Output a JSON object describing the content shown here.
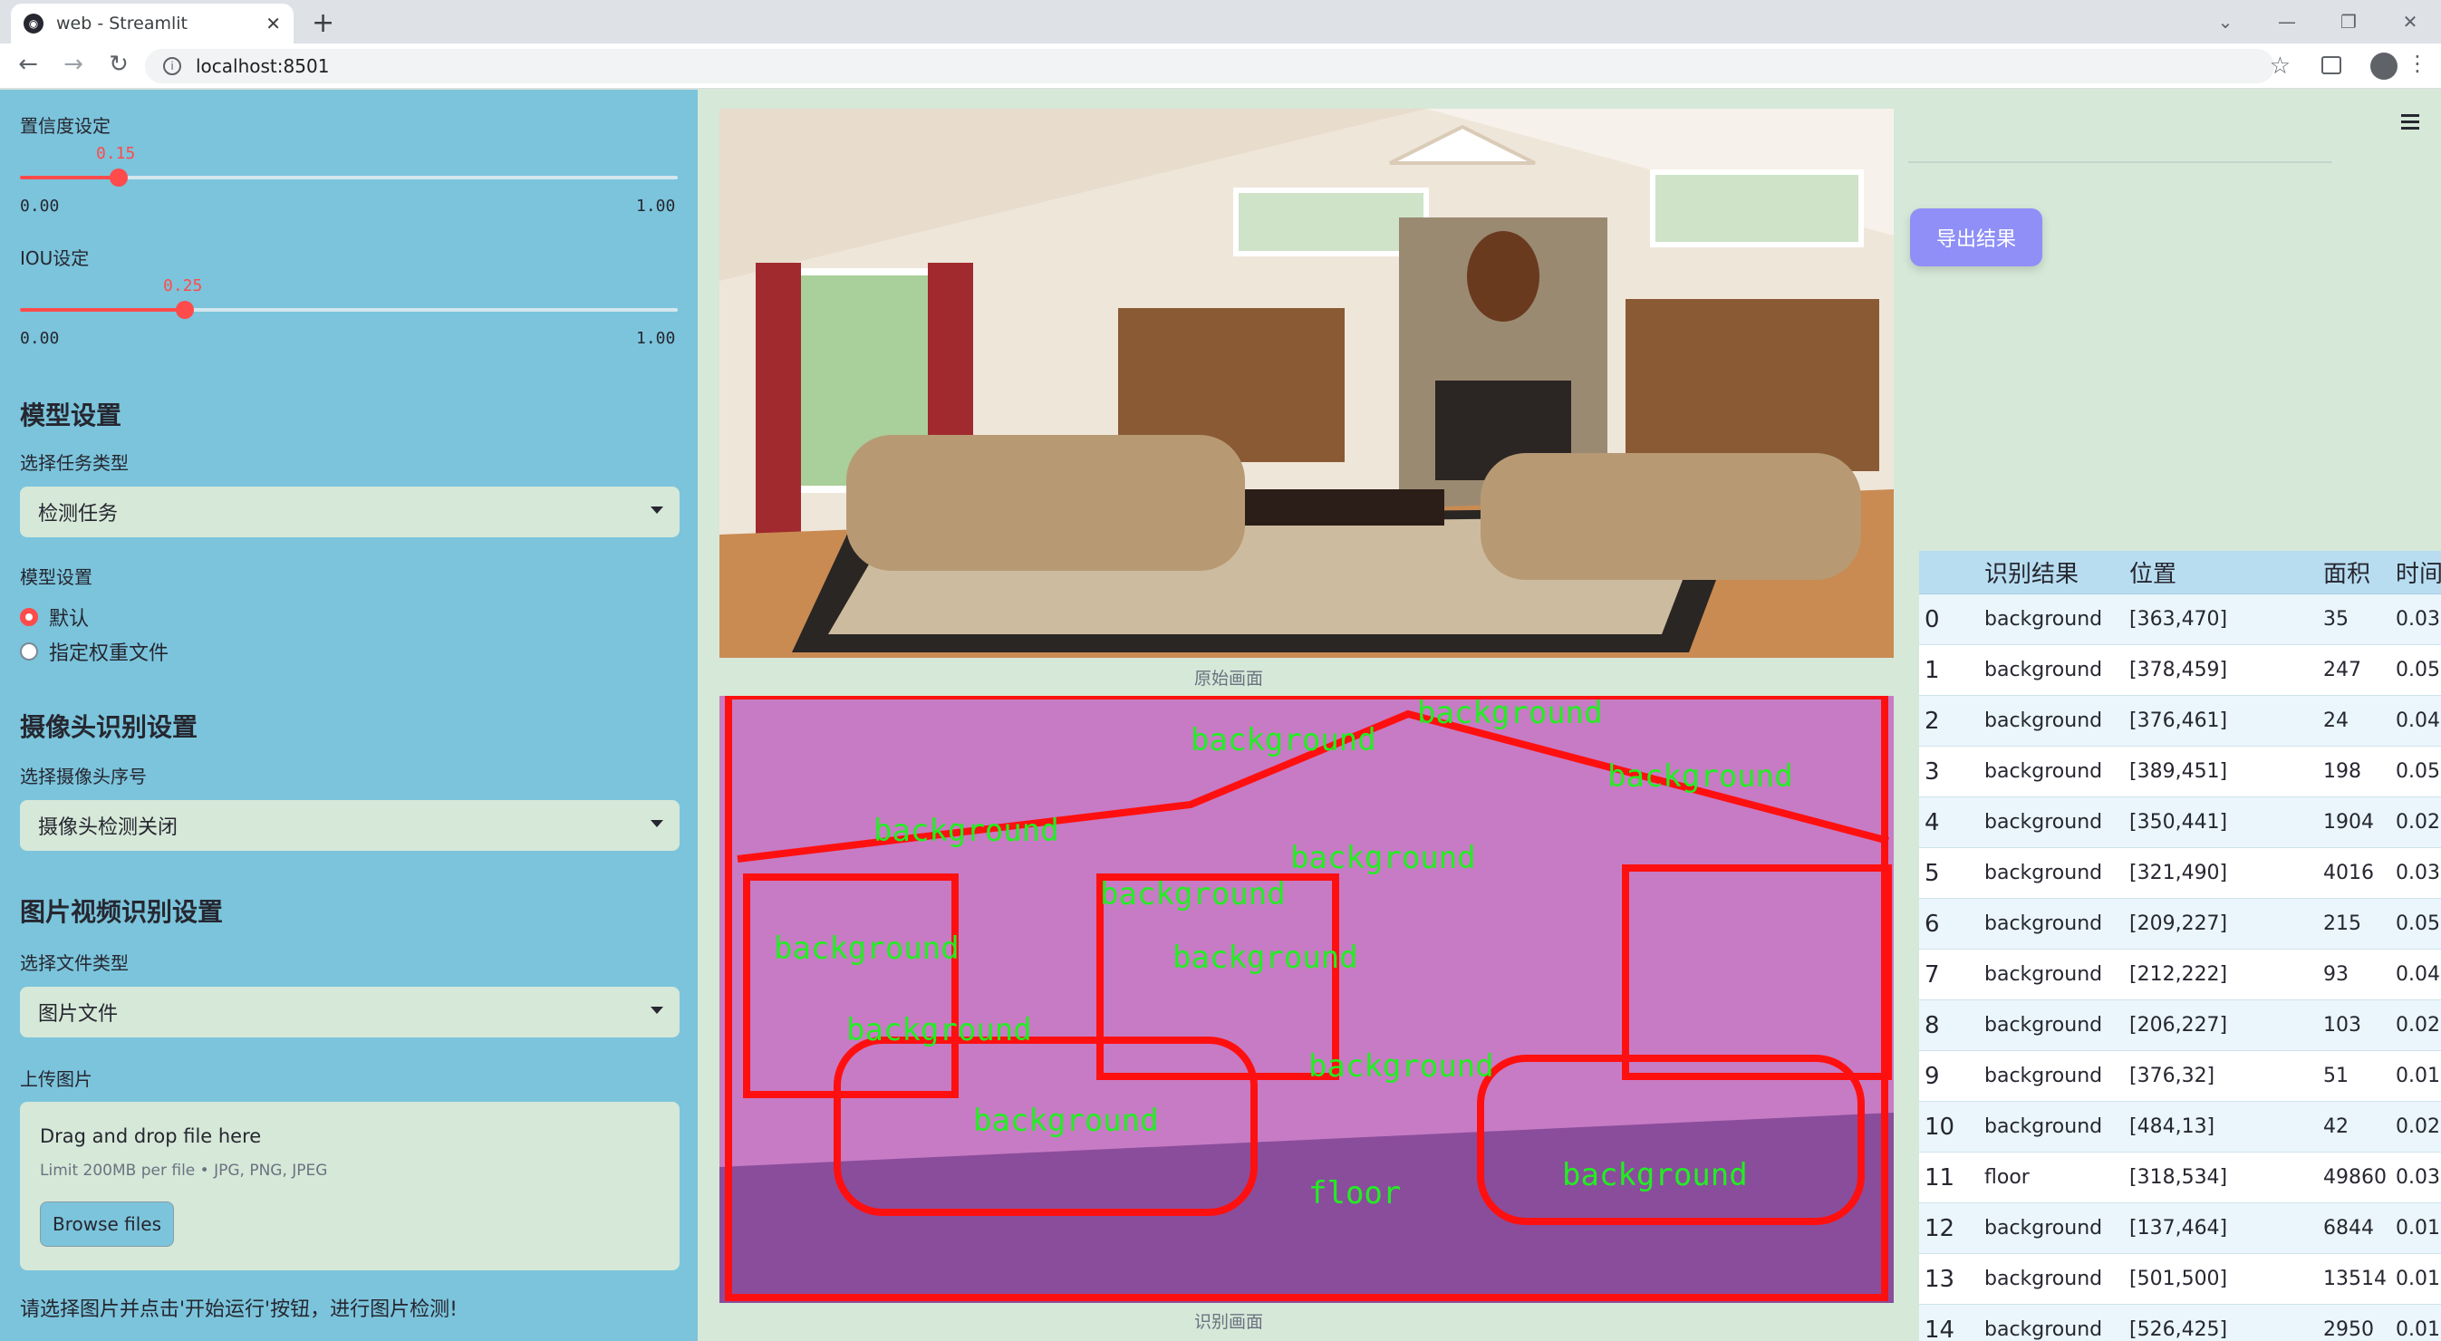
{
  "browser": {
    "tab_title": "web - Streamlit",
    "new_tab": "+",
    "url": "localhost:8501",
    "icons": [
      "streamlit-favicon",
      "close-icon",
      "back-icon",
      "forward-icon",
      "reload-icon",
      "info-icon",
      "star-icon",
      "side-panel-icon",
      "profile-icon",
      "kebab-menu-icon"
    ]
  },
  "sidebar": {
    "confidence": {
      "label": "置信度设定",
      "value": "0.15",
      "min": "0.00",
      "max": "1.00",
      "fraction": 0.15
    },
    "iou": {
      "label": "IOU设定",
      "value": "0.25",
      "min": "0.00",
      "max": "1.00",
      "fraction": 0.25
    },
    "model_section": {
      "title": "模型设置",
      "task_label": "选择任务类型",
      "task_value": "检测任务",
      "model_label": "模型设置",
      "radio_options": [
        "默认",
        "指定权重文件"
      ],
      "radio_selected": 0
    },
    "camera_section": {
      "title": "摄像头识别设置",
      "cam_label": "选择摄像头序号",
      "cam_value": "摄像头检测关闭"
    },
    "media_section": {
      "title": "图片视频识别设置",
      "filetype_label": "选择文件类型",
      "filetype_value": "图片文件",
      "upload_label": "上传图片",
      "drop_text": "Drag and drop file here",
      "limit_text": "Limit 200MB per file • JPG, PNG, JPEG",
      "browse_label": "Browse files"
    },
    "hint": "请选择图片并点击'开始运行'按钮，进行图片检测!"
  },
  "main": {
    "original_caption": "原始画面",
    "result_caption": "识别画面",
    "export_label": "导出结果",
    "overlay_labels": [
      "background",
      "floor"
    ]
  },
  "table": {
    "headers": [
      "",
      "识别结果",
      "位置",
      "面积",
      "时间"
    ],
    "rows": [
      [
        "0",
        "background",
        "[363,470]",
        "35",
        "0.03"
      ],
      [
        "1",
        "background",
        "[378,459]",
        "247",
        "0.05"
      ],
      [
        "2",
        "background",
        "[376,461]",
        "24",
        "0.04"
      ],
      [
        "3",
        "background",
        "[389,451]",
        "198",
        "0.05"
      ],
      [
        "4",
        "background",
        "[350,441]",
        "1904",
        "0.02"
      ],
      [
        "5",
        "background",
        "[321,490]",
        "4016",
        "0.03"
      ],
      [
        "6",
        "background",
        "[209,227]",
        "215",
        "0.05"
      ],
      [
        "7",
        "background",
        "[212,222]",
        "93",
        "0.04"
      ],
      [
        "8",
        "background",
        "[206,227]",
        "103",
        "0.02"
      ],
      [
        "9",
        "background",
        "[376,32]",
        "51",
        "0.01"
      ],
      [
        "10",
        "background",
        "[484,13]",
        "42",
        "0.02"
      ],
      [
        "11",
        "floor",
        "[318,534]",
        "49860",
        "0.03"
      ],
      [
        "12",
        "background",
        "[137,464]",
        "6844",
        "0.01"
      ],
      [
        "13",
        "background",
        "[501,500]",
        "13514",
        "0.01"
      ],
      [
        "14",
        "background",
        "[526,425]",
        "2950",
        "0.01"
      ]
    ]
  }
}
